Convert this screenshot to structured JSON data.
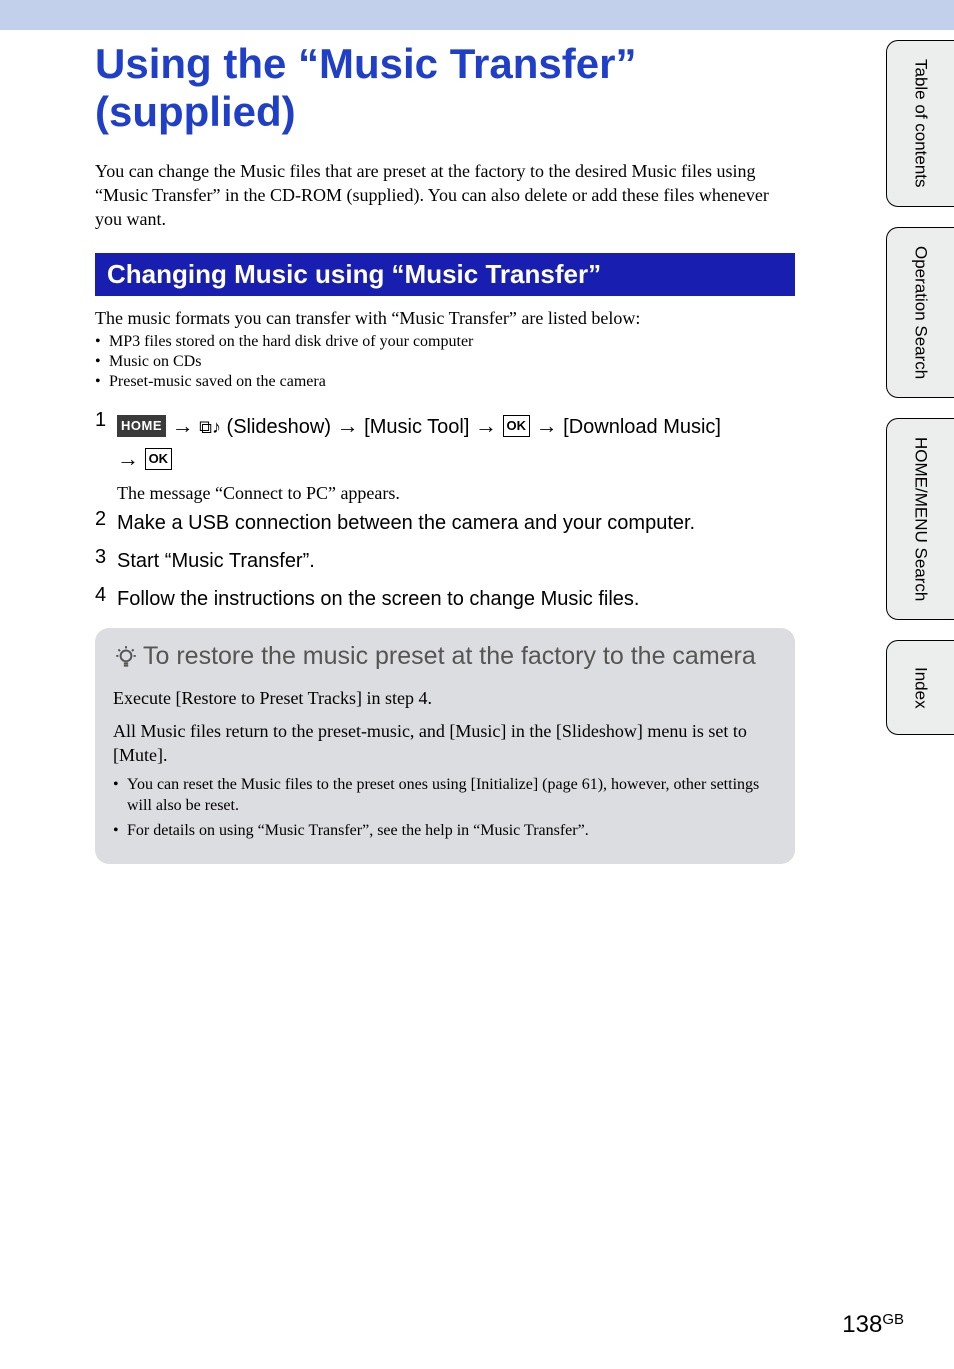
{
  "title": "Using the “Music Transfer” (supplied)",
  "intro": "You can change the Music files that are preset at the factory to the desired Music files using “Music Transfer” in the CD-ROM (supplied). You can also delete or add these files whenever you want.",
  "section_heading": "Changing Music using “Music Transfer”",
  "formats_lead": "The music formats you can transfer with “Music Transfer” are listed below:",
  "format_bullets": [
    "MP3 files stored on the hard disk drive of your computer",
    "Music on CDs",
    "Preset-music saved on the camera"
  ],
  "steps": {
    "s1": {
      "home_label": "HOME",
      "slideshow_label": "(Slideshow)",
      "music_tool_label": "[Music Tool]",
      "ok_label": "OK",
      "download_label": "[Download Music]",
      "arrow": "→"
    },
    "s1_sub": "The message “Connect to PC” appears.",
    "s2": "Make a USB connection between the camera and your computer.",
    "s3": "Start “Music Transfer”.",
    "s4": "Follow the instructions on the screen to change Music files."
  },
  "tip": {
    "title": "To restore the music preset at the factory to the camera",
    "body1": "Execute [Restore to Preset Tracks] in step 4.",
    "body2": "All Music files return to the preset-music, and [Music] in the [Slideshow] menu is set to [Mute].",
    "bullets": [
      "You can reset the Music files to the preset ones using [Initialize] (page 61), however, other settings will also be reset.",
      "For details on using “Music Transfer”, see the help in “Music Transfer”."
    ]
  },
  "side_tabs": {
    "t1": "Table of contents",
    "t2": "Operation Search",
    "t3": "HOME/MENU Search",
    "t4": "Index"
  },
  "page_number": "138",
  "page_suffix": "GB"
}
